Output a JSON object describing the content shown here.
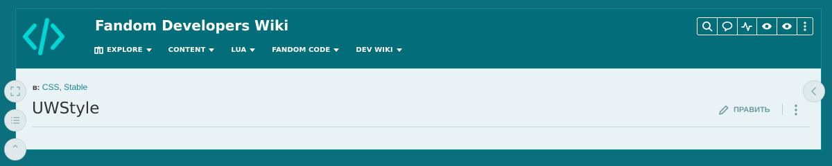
{
  "header": {
    "wiki_title": "Fandom Developers Wiki",
    "logo_icon": "code-brackets-icon",
    "nav": [
      {
        "label": "EXPLORE",
        "icon": "explore-icon"
      },
      {
        "label": "CONTENT"
      },
      {
        "label": "LUA"
      },
      {
        "label": "FANDOM CODE"
      },
      {
        "label": "DEV WIKI"
      }
    ],
    "tools": [
      "search-icon",
      "discussions-icon",
      "activity-icon",
      "eye-icon",
      "eye-icon",
      "more-vertical-icon"
    ]
  },
  "article": {
    "categories_label": "в:",
    "categories": [
      "CSS",
      "Stable"
    ],
    "title": "UWStyle",
    "edit_label": "ПРАВИТЬ"
  },
  "colors": {
    "header_bg": "#036e7a",
    "accent": "#00d6d6",
    "link": "#1a8494",
    "page_bg": "#e9f2f4"
  }
}
